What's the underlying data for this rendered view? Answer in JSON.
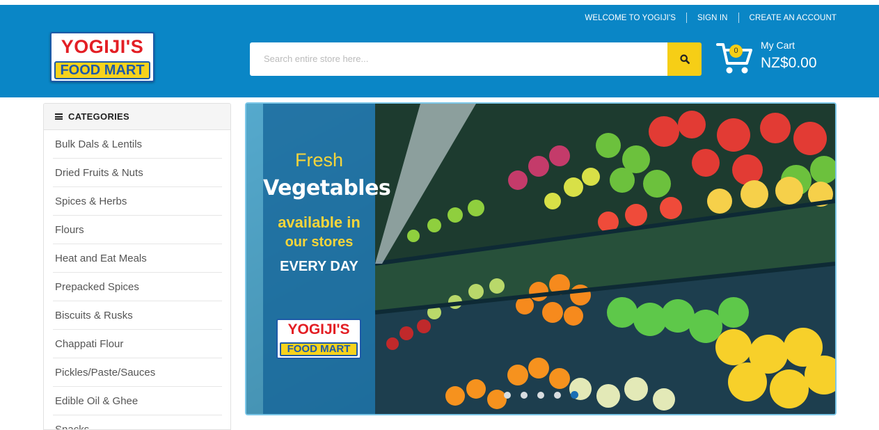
{
  "top_links": [
    "WELCOME TO YOGIJI'S",
    "SIGN IN",
    "CREATE AN ACCOUNT"
  ],
  "logo": {
    "line1": "YOGIJI'S",
    "line2": "FOOD MART"
  },
  "search": {
    "placeholder": "Search entire store here..."
  },
  "cart": {
    "count": "0",
    "label": "My Cart",
    "total": "NZ$0.00"
  },
  "categories": {
    "title": "CATEGORIES",
    "items": [
      "Bulk Dals & Lentils",
      "Dried Fruits & Nuts",
      "Spices & Herbs",
      "Flours",
      "Heat and Eat Meals",
      "Prepacked Spices",
      "Biscuits & Rusks",
      "Chappati Flour",
      "Pickles/Paste/Sauces",
      "Edible Oil & Ghee",
      "Snacks"
    ]
  },
  "banner": {
    "line1": "Fresh",
    "line2": "Vegetables",
    "line3": "available in",
    "line4": "our stores",
    "line5": "EVERY DAY",
    "logo_line1": "YOGIJI'S",
    "logo_line2": "FOOD MART",
    "slides": 5,
    "active_slide": 5
  },
  "colors": {
    "header": "#0a86c6",
    "accent": "#f6ce16",
    "brand_red": "#e31e24",
    "brand_blue": "#1e5aa8"
  }
}
